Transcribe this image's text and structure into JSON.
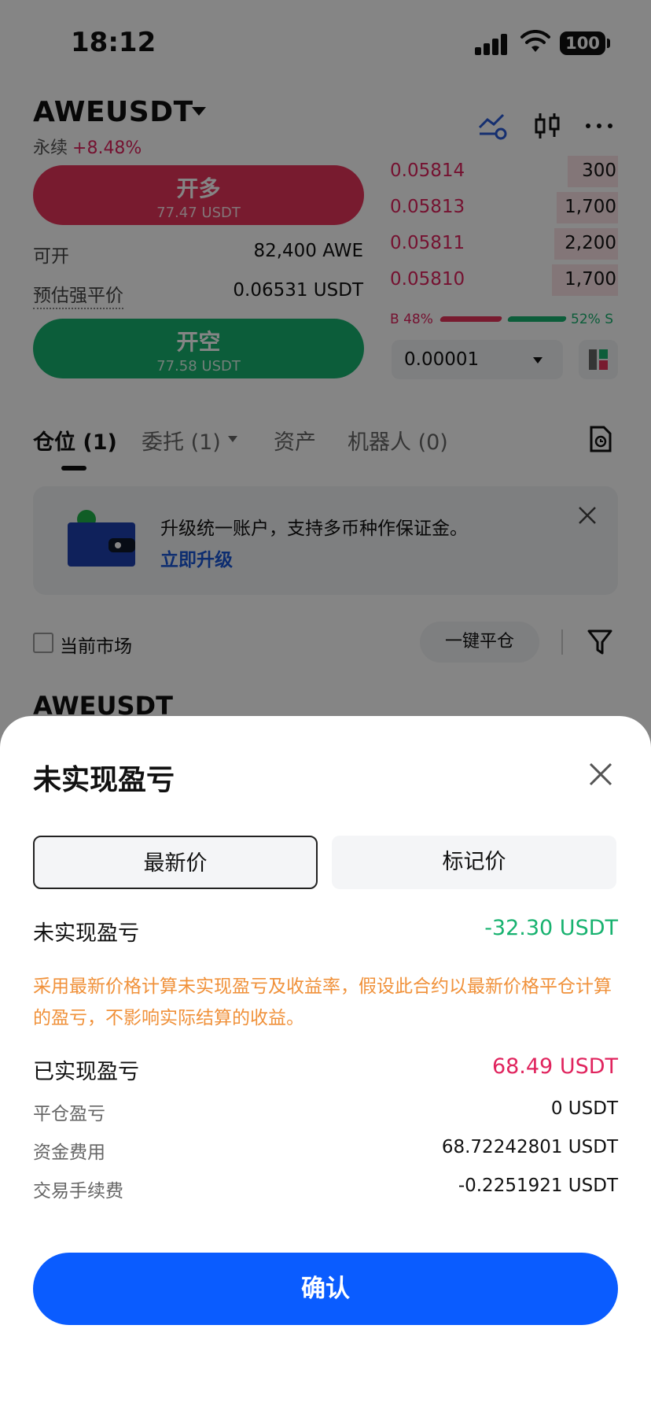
{
  "status": {
    "time": "18:12",
    "battery": "100"
  },
  "header": {
    "pair": "AWEUSDT",
    "contract_type": "永续",
    "change": "+8.48%"
  },
  "trade": {
    "long": {
      "label": "开多",
      "amount": "77.47 USDT"
    },
    "short": {
      "label": "开空",
      "amount": "77.58 USDT"
    },
    "available_label": "可开",
    "available_value": "82,400 AWE",
    "liq_label": "预估强平价",
    "liq_value": "0.06531 USDT"
  },
  "orderbook": {
    "asks": [
      {
        "price": "0.05814",
        "qty": "300",
        "depth": 0.22
      },
      {
        "price": "0.05813",
        "qty": "1,700",
        "depth": 0.27
      },
      {
        "price": "0.05811",
        "qty": "2,200",
        "depth": 0.28
      },
      {
        "price": "0.05810",
        "qty": "1,700",
        "depth": 0.29
      }
    ],
    "buy_ratio": "B 48%",
    "sell_ratio": "52% S",
    "tick_size": "0.00001"
  },
  "tabs": [
    {
      "label": "仓位 (1)"
    },
    {
      "label": "委托 (1)"
    },
    {
      "label": "资产"
    },
    {
      "label": "机器人 (0)"
    }
  ],
  "banner": {
    "text": "升级统一账户，支持多币种作保证金。",
    "link": "立即升级"
  },
  "filter": {
    "current_market": "当前市场",
    "close_all": "一键平仓"
  },
  "position": {
    "pair": "AWEUSDT"
  },
  "sheet": {
    "title": "未实现盈亏",
    "seg_last": "最新价",
    "seg_mark": "标记价",
    "unrealized_label": "未实现盈亏",
    "unrealized_value": "-32.30 USDT",
    "note": "采用最新价格计算未实现盈亏及收益率，假设此合约以最新价格平仓计算的盈亏，不影响实际结算的收益。",
    "realized_label": "已实现盈亏",
    "realized_value": "68.49 USDT",
    "details": [
      {
        "label": "平仓盈亏",
        "value": "0 USDT"
      },
      {
        "label": "资金费用",
        "value": "68.72242801 USDT"
      },
      {
        "label": "交易手续费",
        "value": "-0.2251921 USDT"
      }
    ],
    "confirm": "确认"
  },
  "colors": {
    "up": "#e7355a",
    "down": "#17b26f",
    "primary": "#0a5cff",
    "note": "#f0913a"
  }
}
